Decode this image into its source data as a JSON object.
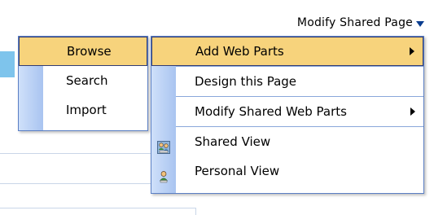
{
  "toolbar": {
    "modify_label": "Modify Shared Page"
  },
  "left_menu": {
    "items": [
      {
        "label": "Browse"
      },
      {
        "label": "Search"
      },
      {
        "label": "Import"
      }
    ]
  },
  "right_menu": {
    "items": [
      {
        "label": "Add Web Parts",
        "submenu": true,
        "icon": null
      },
      {
        "label": "Design this Page",
        "submenu": false,
        "icon": null
      },
      {
        "label": "Modify Shared Web Parts",
        "submenu": true,
        "icon": null
      },
      {
        "label": "Shared View",
        "submenu": false,
        "icon": "shared-view-icon"
      },
      {
        "label": "Personal View",
        "submenu": false,
        "icon": "personal-view-icon"
      }
    ]
  },
  "colors": {
    "highlight": "#f7d37c",
    "menu_border": "#5b7fc4",
    "gutter": "#a9c4f0"
  }
}
